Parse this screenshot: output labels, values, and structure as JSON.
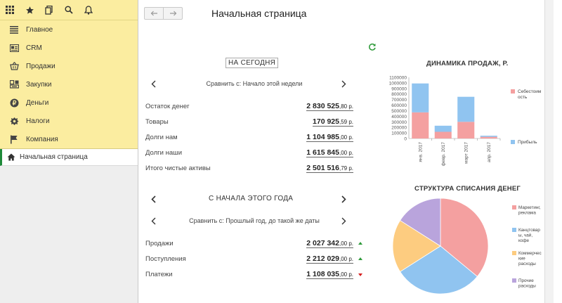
{
  "sidebar": {
    "items": [
      {
        "label": "Главное",
        "icon": "menu-lines-icon"
      },
      {
        "label": "CRM",
        "icon": "crm-card-icon"
      },
      {
        "label": "Продажи",
        "icon": "basket-icon"
      },
      {
        "label": "Закупки",
        "icon": "purchase-icon"
      },
      {
        "label": "Деньги",
        "icon": "money-coin-icon"
      },
      {
        "label": "Налоги",
        "icon": "emblem-icon"
      },
      {
        "label": "Компания",
        "icon": "flag-icon"
      }
    ],
    "open_item": "Начальная страница"
  },
  "page": {
    "title": "Начальная страница"
  },
  "today": {
    "title": "НА СЕГОДНЯ",
    "compare": "Сравнить с: Начало этой недели",
    "rows": [
      {
        "label": "Остаток денег",
        "whole": "2 830 525",
        "frac": ",80 р."
      },
      {
        "label": "Товары",
        "whole": "170 925",
        "frac": ",59 р."
      },
      {
        "label": "Долги нам",
        "whole": "1 104 985",
        "frac": ",00 р."
      },
      {
        "label": "Долги наши",
        "whole": "1 615 845",
        "frac": ",00 р."
      },
      {
        "label": "Итого чистые активы",
        "whole": "2 501 516",
        "frac": ",79 р."
      }
    ]
  },
  "year": {
    "title": "С НАЧАЛА ЭТОГО ГОДА",
    "compare": "Сравнить с: Прошлый год, до такой же даты",
    "rows": [
      {
        "label": "Продажи",
        "whole": "2 027 342",
        "frac": ",00 р.",
        "trend": "up"
      },
      {
        "label": "Поступления",
        "whole": "2 212 029",
        "frac": ",00 р.",
        "trend": "up"
      },
      {
        "label": "Платежи",
        "whole": "1 108 035",
        "frac": ",00 р.",
        "trend": "down"
      }
    ]
  },
  "chart_data": [
    {
      "type": "bar",
      "stacked": true,
      "title": "ДИНАМИКА ПРОДАЖ, Р.",
      "categories": [
        "янв. 2017",
        "февр. 2017",
        "март 2017",
        "апр. 2017"
      ],
      "ylim": [
        0,
        1100000
      ],
      "yticks": [
        "0",
        "100000",
        "200000",
        "300000",
        "400000",
        "500000",
        "600000",
        "700000",
        "800000",
        "900000",
        "1000000",
        "1100000"
      ],
      "series": [
        {
          "name": "Себестоимость",
          "color": "#f4a0a0",
          "values": [
            470000,
            120000,
            300000,
            30000
          ]
        },
        {
          "name": "Прибыль",
          "color": "#90c4f0",
          "values": [
            520000,
            110000,
            450000,
            20000
          ]
        }
      ],
      "legend": [
        {
          "lines": [
            "Себестоим",
            "ость"
          ],
          "color": "#f4a0a0"
        },
        {
          "lines": [
            "Прибыль"
          ],
          "color": "#90c4f0"
        }
      ]
    },
    {
      "type": "pie",
      "title": "СТРУКТУРА СПИСАНИЯ ДЕНЕГ",
      "slices": [
        {
          "name": "Маркетинг, реклама",
          "value": 36,
          "color": "#f4a0a0"
        },
        {
          "name": "Канцтовары, чай, кофе",
          "value": 30,
          "color": "#90c4f0"
        },
        {
          "name": "Коммерческие расходы",
          "value": 18,
          "color": "#fdcc80"
        },
        {
          "name": "Прочие расходы",
          "value": 16,
          "color": "#b9a4dc"
        }
      ],
      "legend": [
        {
          "lines": [
            "Маркетинг,",
            "реклама"
          ],
          "color": "#f4a0a0"
        },
        {
          "lines": [
            "Канцтовар",
            "ы, чай,",
            "кофе"
          ],
          "color": "#90c4f0"
        },
        {
          "lines": [
            "Коммерчес",
            "кие",
            "расходы"
          ],
          "color": "#fdcc80"
        },
        {
          "lines": [
            "Прочие",
            "расходы"
          ],
          "color": "#b9a4dc"
        }
      ]
    }
  ]
}
